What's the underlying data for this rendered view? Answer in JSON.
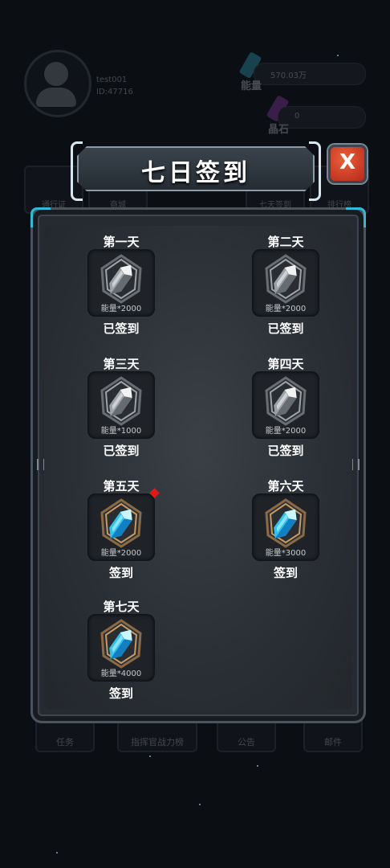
{
  "background": {
    "user_name": "test001",
    "user_id": "ID:47716",
    "energy_value": "570.03万",
    "energy_label": "能量",
    "crystal_value": "0",
    "crystal_label": "晶石",
    "top_buttons": [
      "通行证",
      "商城",
      "七天签到",
      "排行榜"
    ],
    "bottom_buttons": [
      "任务",
      "指挥官战力榜",
      "公告",
      "邮件"
    ]
  },
  "dialog": {
    "title": "七日签到",
    "close_icon": "close-x-icon",
    "close_label": "X",
    "accent_color": "#32b9d8",
    "close_color": "#d5412a"
  },
  "days": [
    {
      "title": "第一天",
      "reward": "能量*2000",
      "status": "已签到",
      "gem": "gray-crystal-icon"
    },
    {
      "title": "第二天",
      "reward": "能量*2000",
      "status": "已签到",
      "gem": "gray-crystal-icon"
    },
    {
      "title": "第三天",
      "reward": "能量*1000",
      "status": "已签到",
      "gem": "gray-crystal-icon"
    },
    {
      "title": "第四天",
      "reward": "能量*2000",
      "status": "已签到",
      "gem": "gray-crystal-icon"
    },
    {
      "title": "第五天",
      "reward": "能量*2000",
      "status": "签到",
      "gem": "blue-crystal-icon",
      "badge": true
    },
    {
      "title": "第六天",
      "reward": "能量*3000",
      "status": "签到",
      "gem": "blue-crystal-icon"
    },
    {
      "title": "第七天",
      "reward": "能量*4000",
      "status": "签到",
      "gem": "blue-crystal-icon"
    }
  ]
}
